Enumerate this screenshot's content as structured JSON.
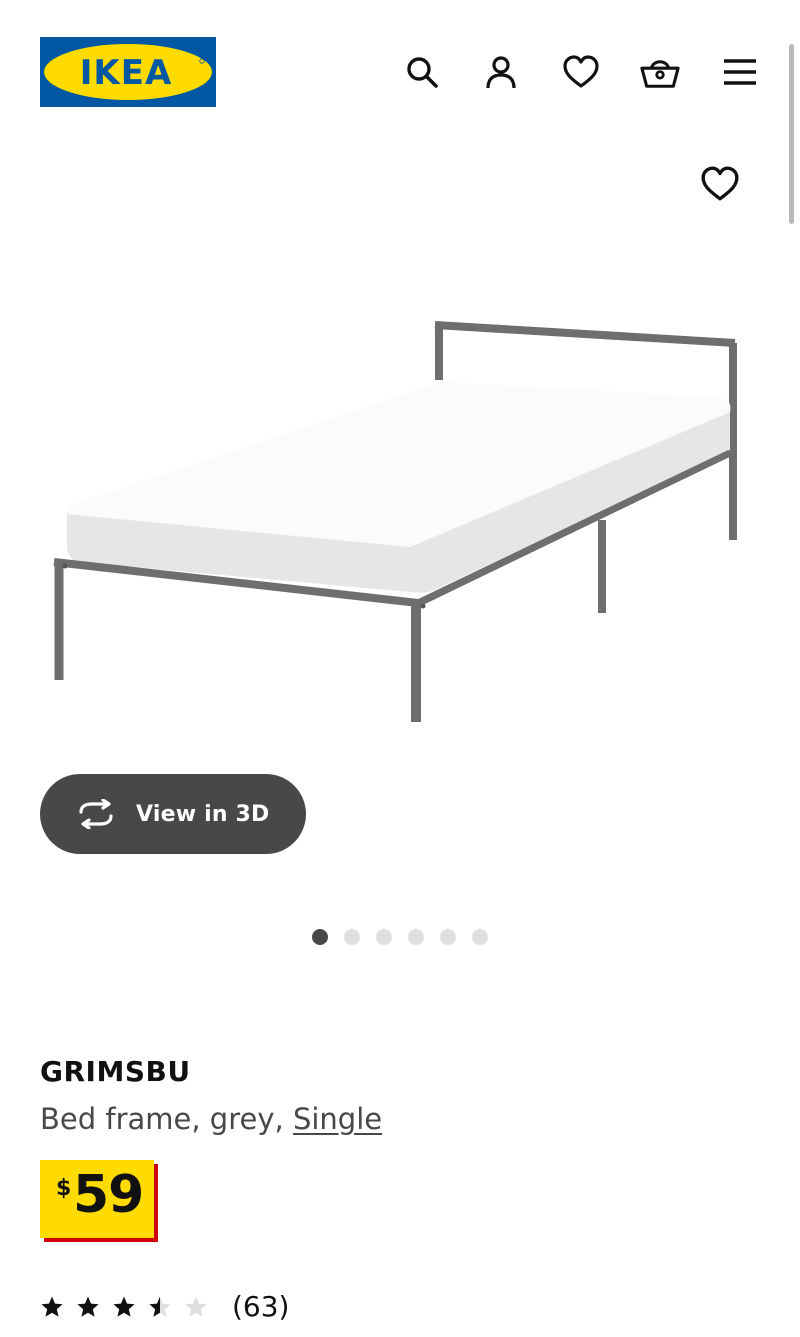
{
  "header": {
    "logo_text": "IKEA",
    "icons": [
      "search-icon",
      "account-icon",
      "heart-icon",
      "basket-icon",
      "menu-icon"
    ]
  },
  "product": {
    "name": "GRIMSBU",
    "description": "Bed frame, grey, ",
    "size_link": "Single",
    "currency": "$",
    "price": "59",
    "rating_value": 3.5,
    "rating_max": 5,
    "review_count": "(63)"
  },
  "gallery": {
    "view3d_label": "View in 3D",
    "image_count": 6,
    "active_index": 0
  },
  "colors": {
    "ikea_blue": "#0058a3",
    "ikea_yellow": "#ffdb00",
    "price_shadow": "#cc0008",
    "button_dark": "#484848"
  }
}
